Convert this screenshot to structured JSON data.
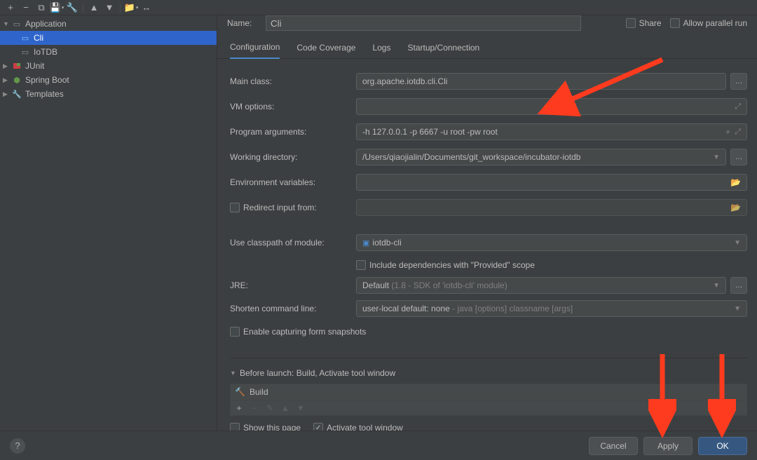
{
  "name_label": "Name:",
  "name_value": "Cli",
  "share_label": "Share",
  "parallel_label": "Allow parallel run",
  "tree": {
    "application": {
      "label": "Application",
      "children": [
        "Cli",
        "IoTDB"
      ]
    },
    "junit": "JUnit",
    "spring": "Spring Boot",
    "templates": "Templates"
  },
  "tabs": [
    "Configuration",
    "Code Coverage",
    "Logs",
    "Startup/Connection"
  ],
  "form": {
    "main_class_lbl": "Main class:",
    "main_class_val": "org.apache.iotdb.cli.Cli",
    "vm_lbl": "VM options:",
    "vm_val": "",
    "args_lbl": "Program arguments:",
    "args_val": "-h 127.0.0.1 -p 6667 -u root -pw root",
    "wd_lbl": "Working directory:",
    "wd_val": "/Users/qiaojialin/Documents/git_workspace/incubator-iotdb",
    "env_lbl": "Environment variables:",
    "env_val": "",
    "redirect_lbl": "Redirect input from:",
    "classpath_lbl": "Use classpath of module:",
    "classpath_val": "iotdb-cli",
    "provided_lbl": "Include dependencies with \"Provided\" scope",
    "jre_lbl": "JRE:",
    "jre_main": "Default",
    "jre_dim": "(1.8 - SDK of 'iotdb-cli' module)",
    "shorten_lbl": "Shorten command line:",
    "shorten_main": "user-local default: none",
    "shorten_dim": "- java [options] classname [args]",
    "snap_lbl": "Enable capturing form snapshots"
  },
  "before_launch": {
    "header": "Before launch: Build, Activate tool window",
    "item": "Build",
    "show_page": "Show this page",
    "activate": "Activate tool window"
  },
  "buttons": {
    "cancel": "Cancel",
    "apply": "Apply",
    "ok": "OK"
  }
}
